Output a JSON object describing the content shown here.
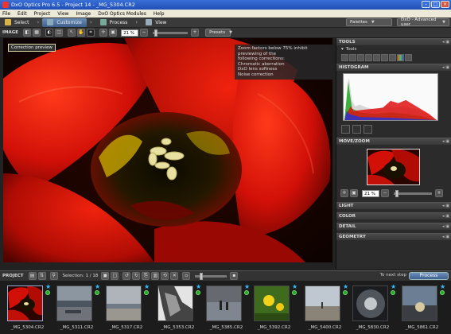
{
  "window": {
    "title": "DxO Optics Pro 6.5 - Project 14 - _MG_5304.CR2"
  },
  "menu": [
    "File",
    "Edit",
    "Project",
    "View",
    "Image",
    "DxO Optics Modules",
    "Help"
  ],
  "workflow": {
    "steps": [
      "Select",
      "Customize",
      "Process",
      "View"
    ],
    "palettes_label": "Palettes",
    "user_mode": "DxO - Advanced user"
  },
  "image_toolbar": {
    "label": "IMAGE",
    "zoom": "21 %",
    "presets": "Presets"
  },
  "viewer": {
    "correction_badge": "Correction preview",
    "zoom_note": [
      "Zoom factors below 75% inhibit previewing of the",
      "following corrections:",
      "Chromatic aberration",
      "DxO lens softness",
      "Noise correction"
    ]
  },
  "palette": {
    "tools_header": "TOOLS",
    "tools_sub": "Tools",
    "histogram_header": "HISTOGRAM",
    "movezoom_header": "MOVE/ZOOM",
    "movezoom_zoom": "21 %",
    "sections": [
      "LIGHT",
      "COLOR",
      "DETAIL",
      "GEOMETRY"
    ]
  },
  "project": {
    "label": "PROJECT",
    "selection": "Selection: 1 / 18",
    "next_step": "To next step",
    "process": "Process"
  },
  "thumbnails": [
    {
      "name": "_MG_5304.CR2",
      "scene": "tulip",
      "selected": true
    },
    {
      "name": "_MG_5311.CR2",
      "scene": "beach"
    },
    {
      "name": "_MG_5317.CR2",
      "scene": "sea"
    },
    {
      "name": "_MG_5353.CR2",
      "scene": "rock"
    },
    {
      "name": "_MG_5385.CR2",
      "scene": "people"
    },
    {
      "name": "_MG_5392.CR2",
      "scene": "dandelion"
    },
    {
      "name": "_MG_5400.CR2",
      "scene": "shore"
    },
    {
      "name": "_MG_5830.CR2",
      "scene": "fisheye"
    },
    {
      "name": "_MG_5861.CR2",
      "scene": "dusk"
    }
  ],
  "colors": {
    "accent": "#3d5f8a",
    "tulip_red": "#d21008",
    "star": "#33bbff",
    "status_ok": "#22aa22"
  }
}
